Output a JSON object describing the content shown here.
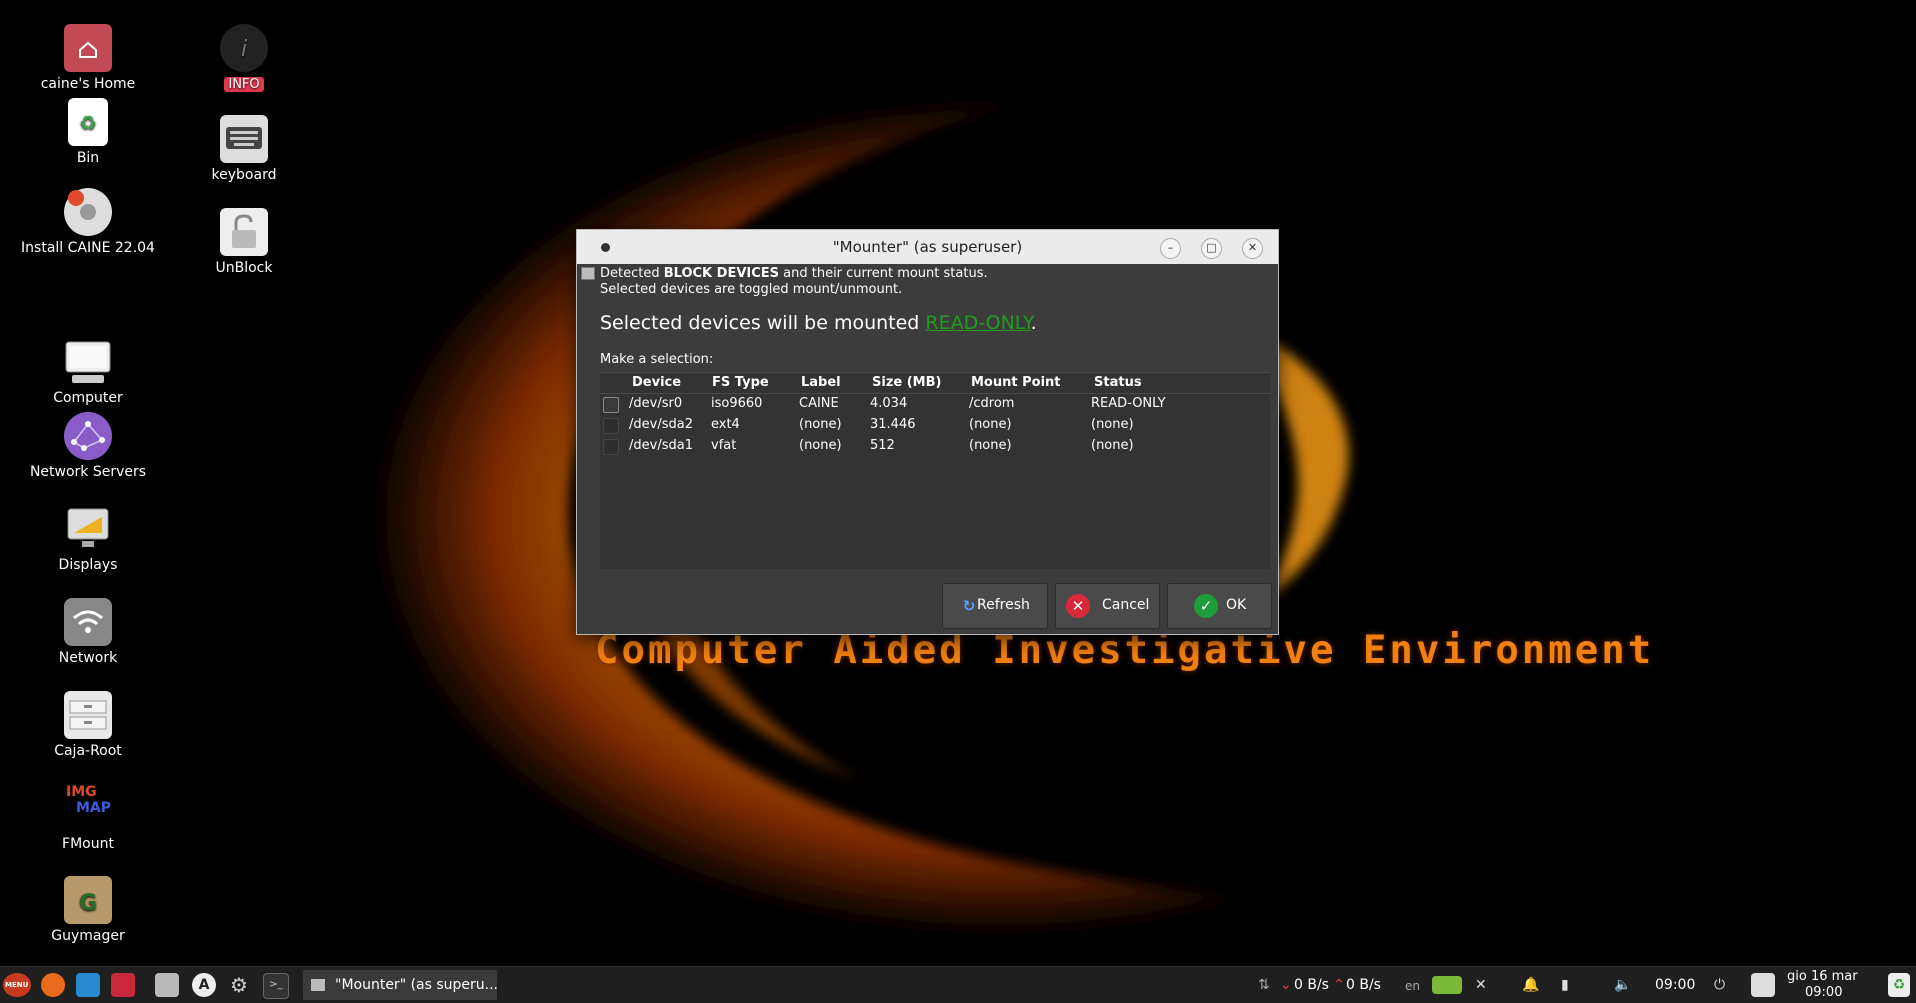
{
  "desktop": {
    "icons": [
      {
        "label": "caine's Home"
      },
      {
        "label": "Bin"
      },
      {
        "label": "Install CAINE 22.04"
      },
      {
        "label": "Computer"
      },
      {
        "label": "Network Servers"
      },
      {
        "label": "Displays"
      },
      {
        "label": "Network"
      },
      {
        "label": "Caja-Root"
      },
      {
        "label": "FMount"
      },
      {
        "label": "Guymager"
      },
      {
        "label": "INFO"
      },
      {
        "label": "keyboard"
      },
      {
        "label": "UnBlock"
      }
    ],
    "tagline": "Computer Aided Investigative Environment",
    "fmount_icon_text": {
      "top": "IMG",
      "bottom": "MAP"
    }
  },
  "window": {
    "title": "\"Mounter\" (as superuser)",
    "info_line1_a": "Detected ",
    "info_line1_bold": "BLOCK DEVICES",
    "info_line1_b": " and their current mount status.",
    "info_line2": "Selected devices are toggled mount/unmount.",
    "mount_msg": "Selected devices will be mounted ",
    "mount_mode": "READ-ONLY",
    "mount_period": ".",
    "make_selection": "Make a selection:",
    "columns": [
      "Device",
      "FS Type",
      "Label",
      "Size (MB)",
      "Mount Point",
      "Status"
    ],
    "rows": [
      {
        "device": "/dev/sr0",
        "fs": "iso9660",
        "label": "CAINE",
        "size": "4.034",
        "mount": "/cdrom",
        "status": "READ-ONLY"
      },
      {
        "device": "/dev/sda2",
        "fs": "ext4",
        "label": "(none)",
        "size": "31.446",
        "mount": "(none)",
        "status": "(none)"
      },
      {
        "device": "/dev/sda1",
        "fs": "vfat",
        "label": "(none)",
        "size": "512",
        "mount": "(none)",
        "status": "(none)"
      }
    ],
    "buttons": {
      "refresh": "Refresh",
      "cancel": "Cancel",
      "ok": "OK"
    }
  },
  "taskbar": {
    "menu_label": "MENU",
    "task_title": "\"Mounter\" (as superu...",
    "net_down": "0 B/s",
    "net_up": "0 B/s",
    "lang": "en",
    "clock": "09:00",
    "date_line1": "gio 16 mar",
    "date_line2": "09:00"
  },
  "colors": {
    "accent_green": "#1f9d1f",
    "tagline_orange": "#f08010",
    "info_badge": "#e0384e"
  }
}
